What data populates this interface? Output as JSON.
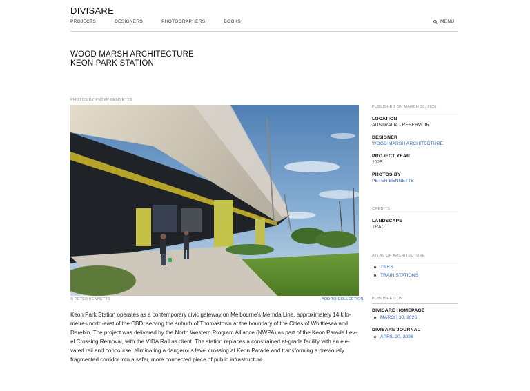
{
  "header": {
    "logo": "DIVISARE",
    "nav": [
      "PROJECTS",
      "DESIGNERS",
      "PHOTOGRAPHERS",
      "BOOKS"
    ],
    "menu_label": "MENU",
    "menu_icon": "search-icon"
  },
  "project": {
    "title_line1": "WOOD MARSH ARCHITECTURE",
    "title_line2": "KEON PARK STATION",
    "photos_by": "PHOTOS BY PETER BENNETTS",
    "image_credit": "© PETER BENNETTS",
    "add_to_collection": "ADD TO COLLECTION",
    "description": "Keon Park Station operates as a contemporary civic gateway on Melbourne's Mernda Line, approximately 14 kilo-metres north-east of the CBD, serving the suburb of Thomastown at the boundary of the Cities of Whittlesea and Darebin. The project was delivered by the North Western Program Alliance (NWPA) as part of the Keon Parade Lev-el Crossing Removal, with the VIDA Rail as client. The station replaces a constrained at-grade facility with an ele-vated rail and concourse, eliminating a dangerous level crossing at Keon Parade and transforming a previously fragmented corridor into a safer, more connected piece of public infrastructure."
  },
  "sidebar": {
    "published": "PUBLISHED ON MARCH 30, 2026",
    "location_label": "LOCATION",
    "location_value": "AUSTRALIA - RESERVOIR",
    "designer_label": "DESIGNER",
    "designer_value": "WOOD MARSH ARCHITECTURE",
    "year_label": "PROJECT YEAR",
    "year_value": "2025",
    "photos_label": "PHOTOS BY",
    "photos_value": "PETER BENNETTS",
    "credits_title": "CREDITS",
    "landscape_label": "LANDSCAPE",
    "landscape_value": "TRACT",
    "atlas_title": "ATLAS OF ARCHITECTURE",
    "atlas_items": [
      "TILES",
      "TRAIN STATIONS"
    ],
    "published_on_title": "PUBLISHED ON",
    "homepage_label": "DIVISARE HOMEPAGE",
    "homepage_date": "MARCH 30, 2026",
    "journal_label": "DIVISARE JOURNAL",
    "journal_date": "APRIL 20, 2026"
  },
  "colors": {
    "link": "#3366cc",
    "rule": "#cfcfcf",
    "sky": "#7aa3c9",
    "grass": "#5d8a2e",
    "concrete": "#c9c2b2"
  }
}
